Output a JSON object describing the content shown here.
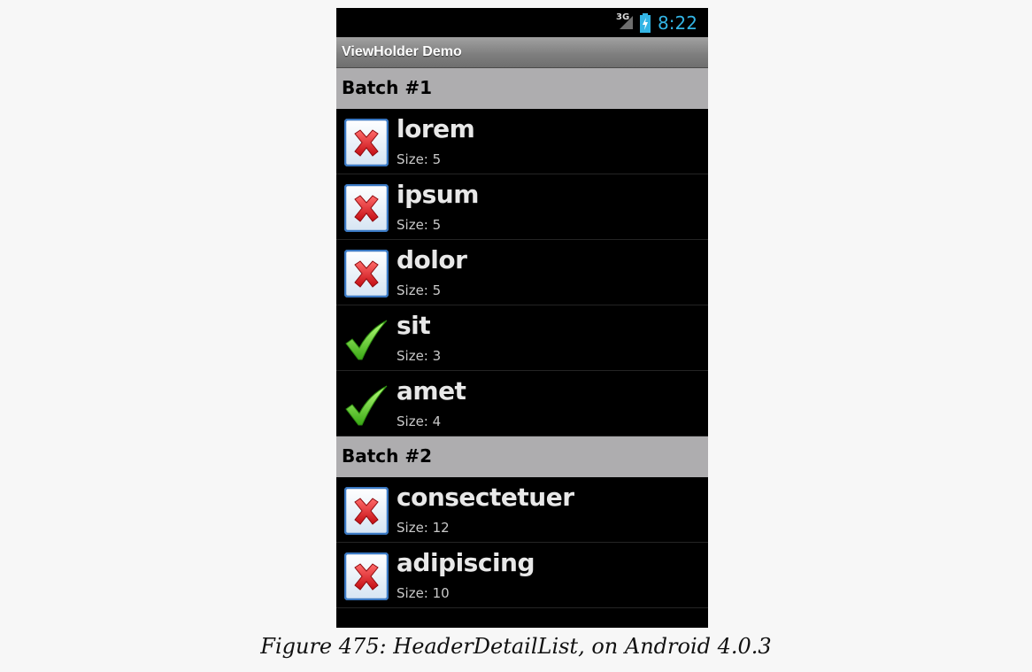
{
  "status_bar": {
    "network": "3G",
    "time": "8:22"
  },
  "action_bar": {
    "title": "ViewHolder Demo"
  },
  "sections": [
    {
      "header": "Batch #1",
      "items": [
        {
          "word": "lorem",
          "size": "Size: 5",
          "icon": "x-icon"
        },
        {
          "word": "ipsum",
          "size": "Size: 5",
          "icon": "x-icon"
        },
        {
          "word": "dolor",
          "size": "Size: 5",
          "icon": "x-icon"
        },
        {
          "word": "sit",
          "size": "Size: 3",
          "icon": "check-icon"
        },
        {
          "word": "amet",
          "size": "Size: 4",
          "icon": "check-icon"
        }
      ]
    },
    {
      "header": "Batch #2",
      "items": [
        {
          "word": "consectetuer",
          "size": "Size: 12",
          "icon": "x-icon"
        },
        {
          "word": "adipiscing",
          "size": "Size: 10",
          "icon": "x-icon"
        }
      ]
    }
  ],
  "caption": "Figure 475: HeaderDetailList, on Android 4.0.3",
  "colors": {
    "accent_clock": "#33b5e5",
    "header_bg": "#aeadaf",
    "x_red": "#d8141a",
    "check_green": "#5cc71f"
  }
}
